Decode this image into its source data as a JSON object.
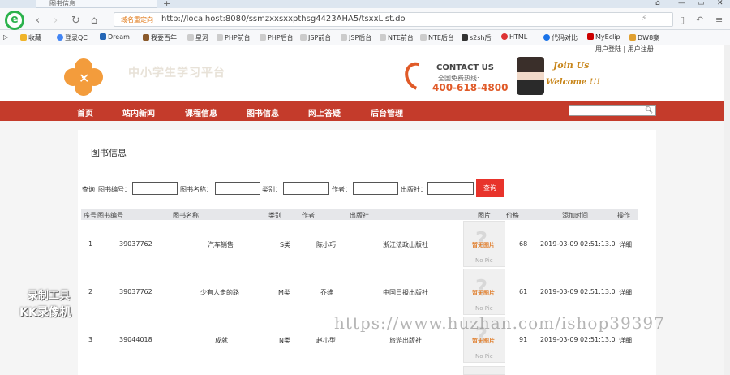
{
  "browser": {
    "tab_title": "图书信息",
    "secure_label": "域名重定向",
    "url": "http://localhost:8080/ssmzxxsxxpthsg4423AHA5/tsxxList.do",
    "bookmarks": [
      "收藏",
      "登录QC",
      "Dream",
      "我要百年",
      "星河",
      "PHP前台",
      "PHP后台",
      "JSP前台",
      "JSP后台",
      "NTE前台",
      "NTE后台",
      "s2sh后",
      "HTML",
      "代码对比",
      "MyEclip",
      "DW8案"
    ]
  },
  "header": {
    "user_links": "用户登陆 | 用户注册",
    "site_title": "中小学生学习平台",
    "contact_title": "CONTACT US",
    "contact_sub": "全国免费热线:",
    "contact_phone": "400-618-4800",
    "join1": "Join Us",
    "join2": "Welcome !!!"
  },
  "nav": {
    "items": [
      "首页",
      "站内新闻",
      "课程信息",
      "图书信息",
      "网上答疑",
      "后台管理"
    ]
  },
  "page": {
    "title": "图书信息",
    "filters": {
      "search_label": "查询",
      "f1": "图书编号：",
      "f2": "图书名称：",
      "f3": "类别：",
      "f4": "作者：",
      "f5": "出版社：",
      "button": "查询"
    },
    "columns": [
      "序号",
      "图书编号",
      "图书名称",
      "类别",
      "作者",
      "出版社",
      "图片",
      "价格",
      "添加时间",
      "操作"
    ],
    "rows": [
      {
        "no": "1",
        "code": "39037762",
        "name": "汽车销售",
        "cat": "S类",
        "author": "陈小巧",
        "pub": "浙江法政出版社",
        "price": "68",
        "time": "2019-03-09 02:51:13.0",
        "op": "详细"
      },
      {
        "no": "2",
        "code": "39037762",
        "name": "少有人走的路",
        "cat": "M类",
        "author": "乔维",
        "pub": "中国日报出版社",
        "price": "61",
        "time": "2019-03-09 02:51:13.0",
        "op": "详细"
      },
      {
        "no": "3",
        "code": "39044018",
        "name": "成就",
        "cat": "N类",
        "author": "赵小型",
        "pub": "旅游出版社",
        "price": "91",
        "time": "2019-03-09 02:51:13.0",
        "op": "详细"
      }
    ],
    "nopic_cn": "暂无图片",
    "nopic_en": "No Pic"
  },
  "watermark": {
    "line1": "录制工具",
    "line2": "KK录像机",
    "site": "https://www.huzhan.com/ishop39397"
  }
}
